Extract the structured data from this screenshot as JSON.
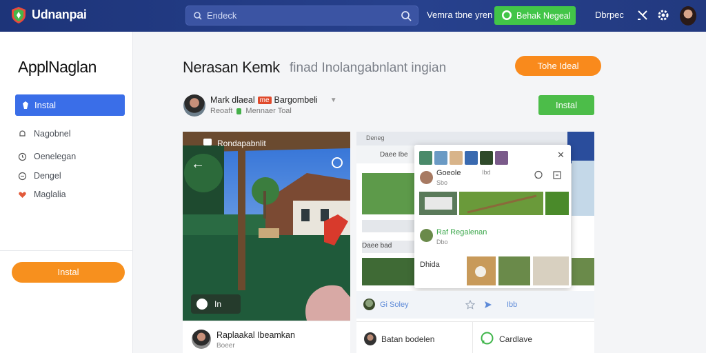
{
  "header": {
    "brand": "Udnanpai",
    "search_placeholder": "Endeck",
    "nav_link": "Vemra tbne yren",
    "green_button": "Behak Negeal",
    "nav_link2": "Dbrpec"
  },
  "sidebar": {
    "title": "ApplNaglan",
    "active_item": "Instal",
    "items": [
      {
        "label": "Nagobnel",
        "icon": "bell-icon"
      },
      {
        "label": "Oenelegan",
        "icon": "clock-icon"
      },
      {
        "label": "Dengel",
        "icon": "circle-icon"
      },
      {
        "label": "Maglalia",
        "icon": "heart-icon"
      }
    ],
    "install_button": "Instal"
  },
  "main": {
    "title": "Nerasan Kemk",
    "subtitle": "finad Inolangabnlant ingian",
    "orange_button": "Tohe Ideal",
    "author": {
      "name_a": "Mark dlaeal",
      "tag": "me",
      "name_b": "Bargombeli",
      "meta_a": "Reoaft",
      "meta_b": "Mennaer Toal"
    },
    "install_button": "Instal"
  },
  "card_left": {
    "photo_label": "Rondapabnlit",
    "pill_label": "In",
    "footer_name": "Raplaakal Ibeamkan",
    "footer_meta": "Boeer"
  },
  "card_right": {
    "top_label": "Deneg",
    "bar_label": "Daee Ibe",
    "popup": {
      "user1_name": "Goeole",
      "user1_meta": "Sbo",
      "user1_meta2": "Ibd",
      "user2_name": "Raf Regalenan",
      "user2_meta": "Dbo",
      "section_label": "Dhida"
    },
    "row_label": "Gi Soley",
    "row_label2": "Ibb",
    "row_left_label": "Daee bad",
    "footer_left": "Batan bodelen",
    "footer_right": "Cardlave"
  },
  "colors": {
    "topbar": "#22397f",
    "accent_blue": "#3a6ee8",
    "accent_green": "#42c548",
    "accent_orange": "#f7901e"
  }
}
